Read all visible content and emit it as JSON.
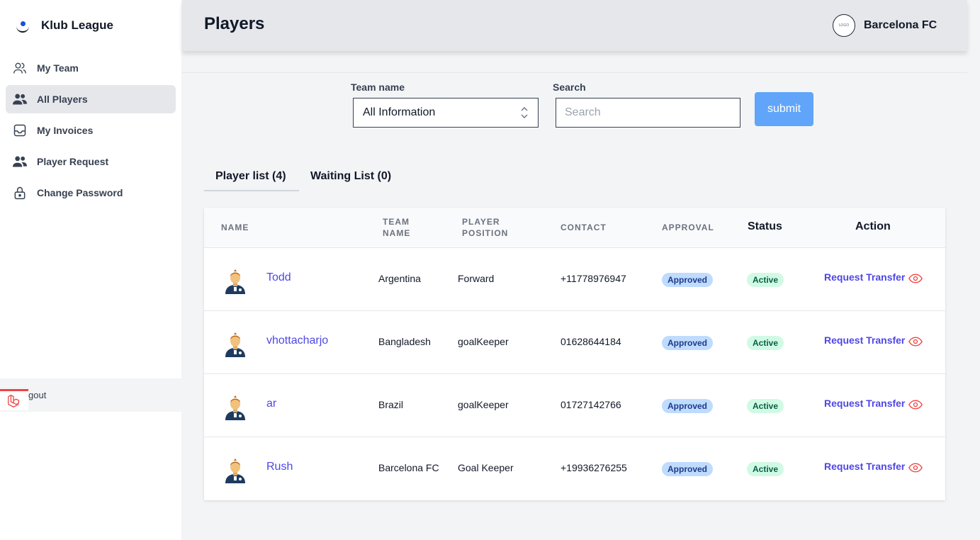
{
  "brand": {
    "name": "Klub League"
  },
  "sidebar": {
    "items": [
      {
        "label": "My Team",
        "icon": "users-outline-icon"
      },
      {
        "label": "All Players",
        "icon": "users-solid-icon"
      },
      {
        "label": "My Invoices",
        "icon": "inbox-icon"
      },
      {
        "label": "Player Request",
        "icon": "users-solid-icon"
      },
      {
        "label": "Change Password",
        "icon": "lock-icon"
      }
    ],
    "logout_label": "Logout",
    "logout_visible_label": "gout"
  },
  "header": {
    "title": "Players",
    "club_logo_text": "LOGO",
    "club_name": "Barcelona FC"
  },
  "filter": {
    "team_label": "Team name",
    "team_value": "All Information",
    "search_label": "Search",
    "search_placeholder": "Search",
    "submit_label": "submit"
  },
  "tabs": [
    {
      "label": "Player list (4)",
      "active": true
    },
    {
      "label": "Waiting List (0)",
      "active": false
    }
  ],
  "table": {
    "headers": {
      "name": "NAME",
      "team_name_1": "TEAM",
      "team_name_2": "NAME",
      "position_1": "PLAYER",
      "position_2": "POSITION",
      "contact": "CONTACT",
      "approval": "APPROVAL",
      "status": "Status",
      "action": "Action"
    },
    "rows": [
      {
        "name": "Todd",
        "team": "Argentina",
        "position": "Forward",
        "contact": "+11778976947",
        "approval": "Approved",
        "status": "Active",
        "action": "Request Transfer"
      },
      {
        "name": "vhottacharjo",
        "team": "Bangladesh",
        "position": "goalKeeper",
        "contact": "01628644184",
        "approval": "Approved",
        "status": "Active",
        "action": "Request Transfer"
      },
      {
        "name": "ar",
        "team": "Brazil",
        "position": "goalKeeper",
        "contact": "01727142766",
        "approval": "Approved",
        "status": "Active",
        "action": "Request Transfer"
      },
      {
        "name": "Rush",
        "team": "Barcelona FC",
        "position": "Goal Keeper",
        "contact": "+19936276255",
        "approval": "Approved",
        "status": "Active",
        "action": "Request Transfer"
      }
    ]
  },
  "colors": {
    "accent": "#4f46e5",
    "submit": "#60a5fa",
    "approved_bg": "#bfdbfe",
    "active_bg": "#d1fae5",
    "eye": "#ef4444"
  }
}
